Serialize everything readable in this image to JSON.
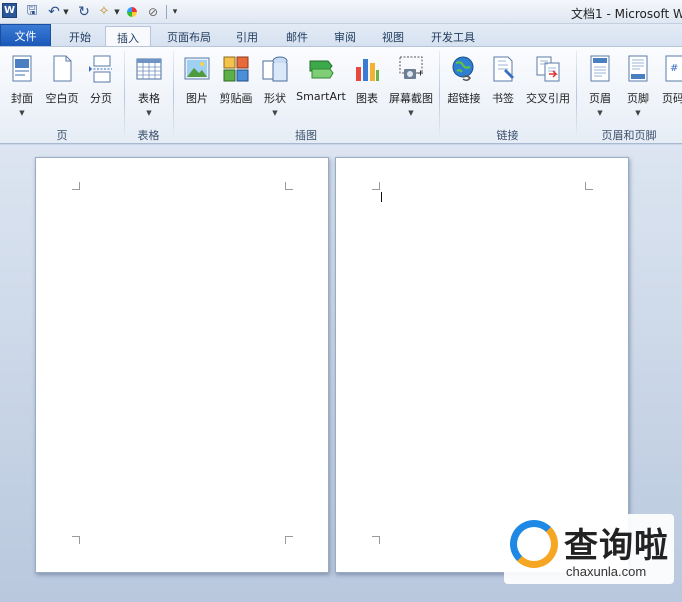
{
  "window": {
    "title": "文档1 - Microsoft W"
  },
  "quick_access": {
    "word_logo": "W",
    "icons": [
      "word-logo-icon",
      "save-icon",
      "undo-icon",
      "redo-icon",
      "format-painter-icon",
      "color-icon",
      "clear-format-icon",
      "customize-icon"
    ]
  },
  "tabs": [
    {
      "label": "文件"
    },
    {
      "label": "开始"
    },
    {
      "label": "插入"
    },
    {
      "label": "页面布局"
    },
    {
      "label": "引用"
    },
    {
      "label": "邮件"
    },
    {
      "label": "审阅"
    },
    {
      "label": "视图"
    },
    {
      "label": "开发工具"
    }
  ],
  "active_tab": "插入",
  "ribbon": {
    "buttons": [
      {
        "label": "封面",
        "icon": "cover-page-icon"
      },
      {
        "label": "空白页",
        "icon": "blank-page-icon"
      },
      {
        "label": "分页",
        "icon": "page-break-icon"
      },
      {
        "label": "表格",
        "icon": "table-icon"
      },
      {
        "label": "图片",
        "icon": "picture-icon"
      },
      {
        "label": "剪贴画",
        "icon": "clip-art-icon"
      },
      {
        "label": "形状",
        "icon": "shapes-icon"
      },
      {
        "label": "SmartArt",
        "icon": "smartart-icon"
      },
      {
        "label": "图表",
        "icon": "chart-icon"
      },
      {
        "label": "屏幕截图",
        "icon": "screenshot-icon"
      },
      {
        "label": "超链接",
        "icon": "hyperlink-icon"
      },
      {
        "label": "书签",
        "icon": "bookmark-icon"
      },
      {
        "label": "交叉引用",
        "icon": "cross-reference-icon"
      },
      {
        "label": "页眉",
        "icon": "header-icon"
      },
      {
        "label": "页脚",
        "icon": "footer-icon"
      },
      {
        "label": "页码",
        "icon": "page-number-icon"
      }
    ],
    "groups": [
      {
        "label": "页"
      },
      {
        "label": "表格"
      },
      {
        "label": "插图"
      },
      {
        "label": "链接"
      },
      {
        "label": "页眉和页脚"
      }
    ]
  },
  "watermark": {
    "text": "查询啦",
    "url": "chaxunla.com"
  },
  "colors": {
    "file_tab": "#1b58b8",
    "accent_blue": "#1e88e5",
    "accent_orange": "#f5a623"
  }
}
